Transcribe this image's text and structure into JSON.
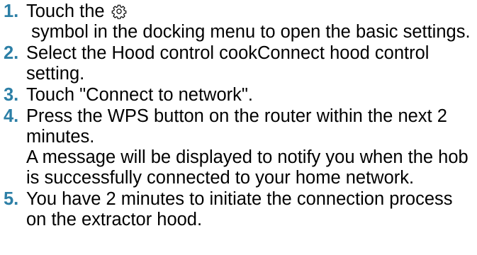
{
  "accent_color": "#2c7fa6",
  "steps": [
    {
      "number": "1.",
      "text_before_icon": "Touch the ",
      "icon": "gear-icon",
      "text_after_icon": " symbol in the docking menu to open the basic settings."
    },
    {
      "number": "2.",
      "text": "Select the Hood control cookConnect hood control setting."
    },
    {
      "number": "3.",
      "text": "Touch \"Connect to network\"."
    },
    {
      "number": "4.",
      "text": "Press the WPS button on the router within the next 2 minutes.",
      "result": "A message will be displayed to notify you when the hob is successfully connected to your home network."
    },
    {
      "number": "5.",
      "text": "You have 2 minutes to initiate the connection process on the extractor hood."
    }
  ]
}
